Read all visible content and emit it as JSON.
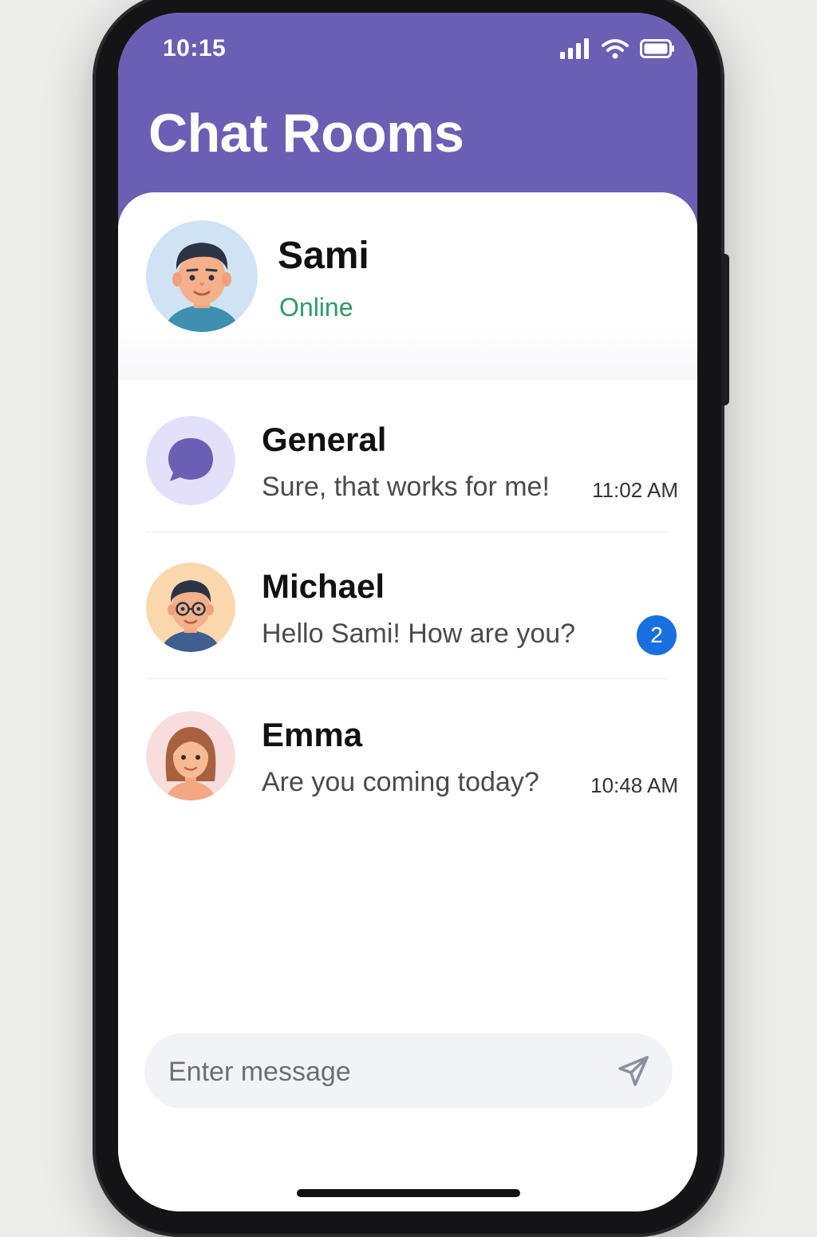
{
  "status_bar": {
    "time": "10:15",
    "icons": [
      "cellular-signal-icon",
      "wifi-icon",
      "battery-icon"
    ]
  },
  "header": {
    "title": "Chat Rooms"
  },
  "profile": {
    "name": "Sami",
    "status": "Online",
    "avatar": "male-avatar"
  },
  "rooms": [
    {
      "name": "General",
      "preview": "Sure, that works for me!",
      "time": "11:02 AM",
      "avatar": "chat-bubble-icon"
    },
    {
      "name": "Michael",
      "preview": "Hello Sami! How are you?",
      "unread": "2",
      "avatar": "male-glasses-avatar"
    },
    {
      "name": "Emma",
      "preview": "Are you coming today?",
      "time": "10:48 AM",
      "avatar": "female-avatar"
    }
  ],
  "composer": {
    "placeholder": "Enter message",
    "send_icon": "send-icon"
  },
  "colors": {
    "header": "#6b5fb3",
    "online": "#2f9a62",
    "badge": "#1a6fe0"
  }
}
